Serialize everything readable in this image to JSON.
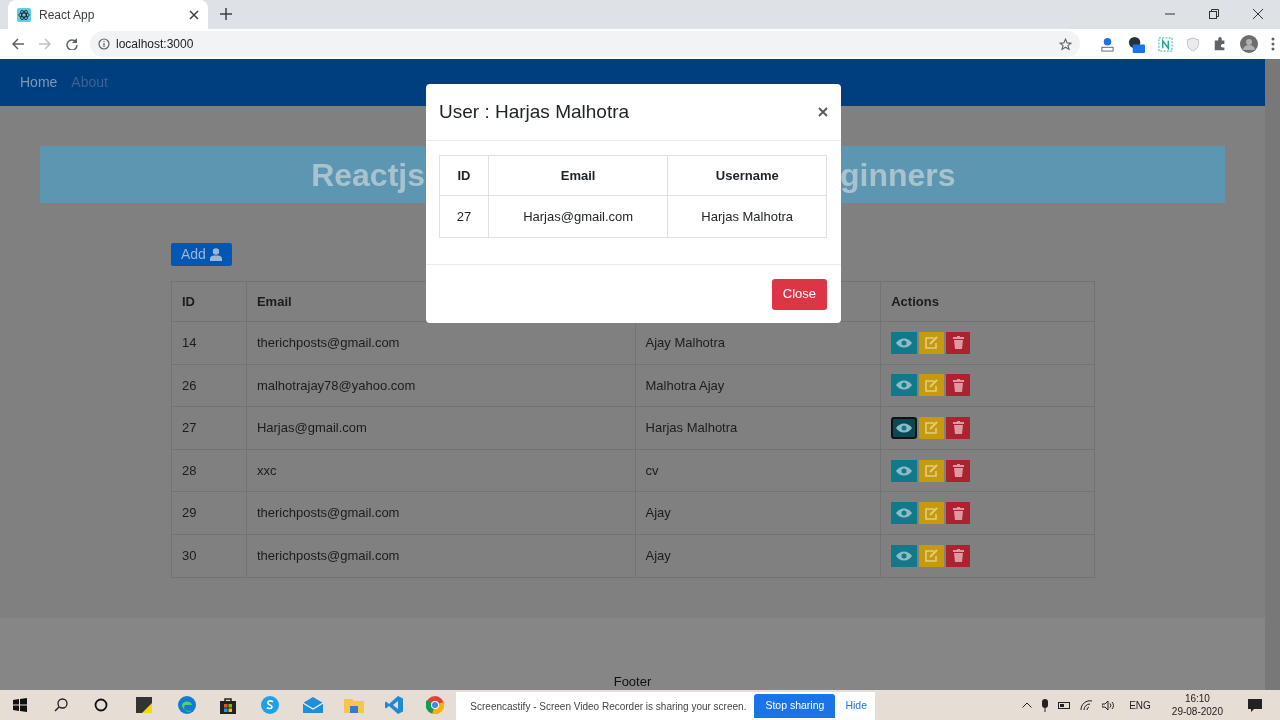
{
  "browser": {
    "tab_title": "React App",
    "address": "localhost:3000"
  },
  "navbar": {
    "items": [
      {
        "label": "Home",
        "selected": true
      },
      {
        "label": "About",
        "selected": false
      }
    ]
  },
  "banner": {
    "text_left": "Reactjs",
    "text_right": "ginners"
  },
  "add_button": "Add",
  "table": {
    "columns": [
      "ID",
      "Email",
      "Actions"
    ],
    "rows": [
      {
        "id": "14",
        "email": "therichposts@gmail.com",
        "username": "Ajay Malhotra",
        "view_hovered": false
      },
      {
        "id": "26",
        "email": "malhotrajay78@yahoo.com",
        "username": "Malhotra Ajay",
        "view_hovered": false
      },
      {
        "id": "27",
        "email": "Harjas@gmail.com",
        "username": "Harjas Malhotra",
        "view_hovered": true
      },
      {
        "id": "28",
        "email": "xxc",
        "username": "cv",
        "view_hovered": false
      },
      {
        "id": "29",
        "email": "therichposts@gmail.com",
        "username": "Ajay",
        "view_hovered": false
      },
      {
        "id": "30",
        "email": "therichposts@gmail.com",
        "username": "Ajay",
        "view_hovered": false
      }
    ]
  },
  "modal": {
    "title": "User : Harjas Malhotra",
    "columns": [
      "ID",
      "Email",
      "Username"
    ],
    "row": [
      "27",
      "Harjas@gmail.com",
      "Harjas Malhotra"
    ],
    "close_button": "Close"
  },
  "footer": "Footer",
  "sharing_bar": {
    "message": "Screencastify - Screen Video Recorder is sharing your screen.",
    "stop_button": "Stop sharing",
    "hide_link": "Hide"
  },
  "taskbar": {
    "language": "ENG",
    "time": "16:10",
    "date": "29-08-2020"
  }
}
